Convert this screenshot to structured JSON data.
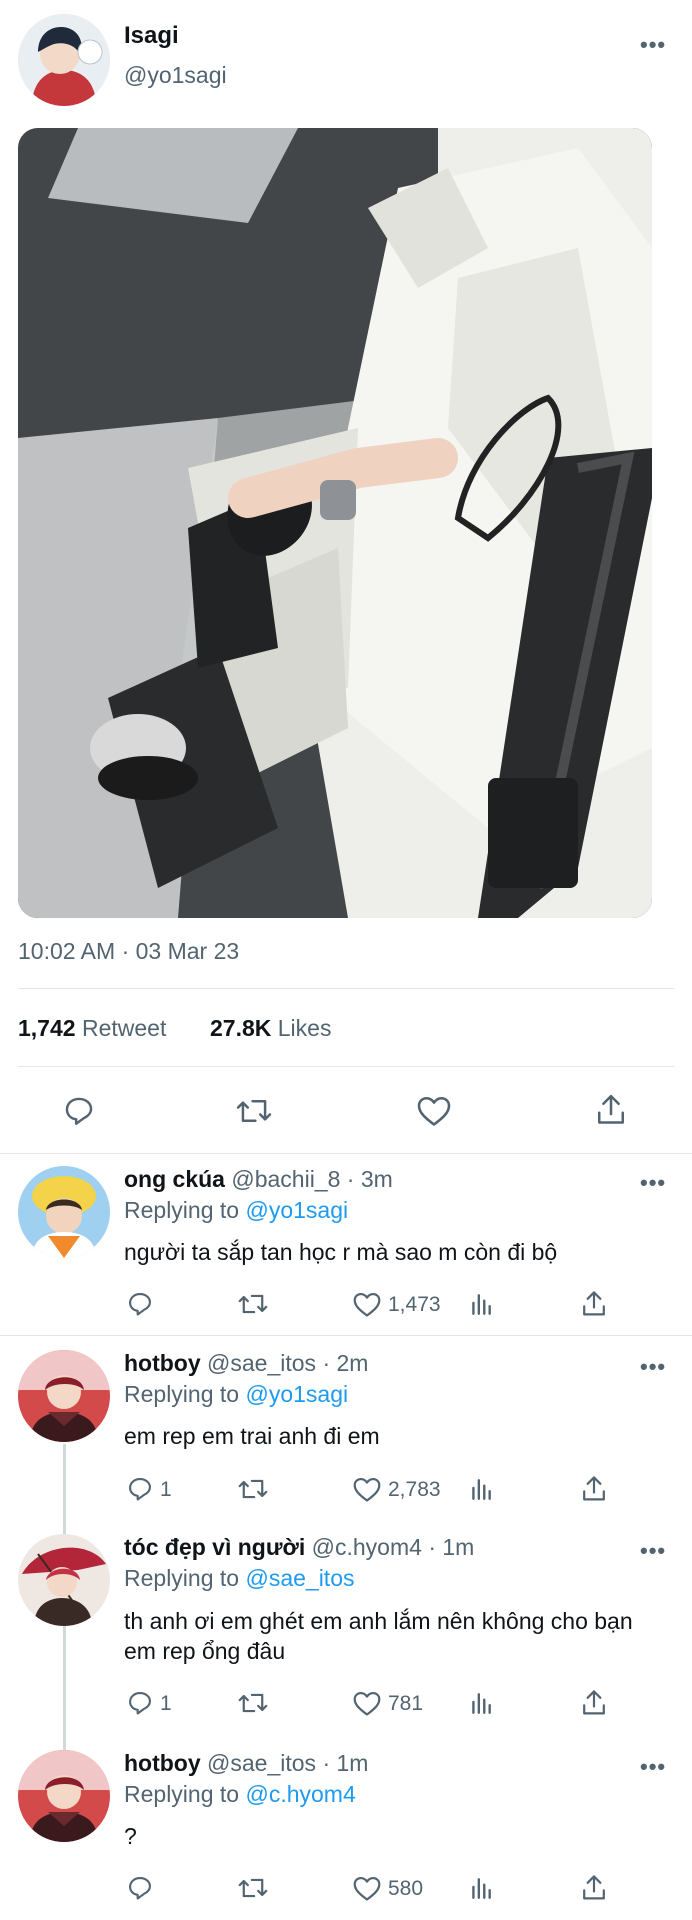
{
  "tweet": {
    "display_name": "Isagi",
    "handle": "@yo1sagi",
    "timestamp": "10:02 AM · 03 Mar 23",
    "retweet_count": "1,742",
    "retweet_label": "Retweet",
    "likes_count": "27.8K",
    "likes_label": "Likes",
    "more": "•••"
  },
  "replies": [
    {
      "display_name": "ong ckúa",
      "handle": "@bachii_8",
      "time": "· 3m",
      "replying_label": "Replying to",
      "replying_to": "@yo1sagi",
      "text": "người ta sắp tan học r mà sao m còn đi bộ",
      "reply_count": "",
      "like_count": "1,473"
    },
    {
      "display_name": "hotboy",
      "handle": "@sae_itos",
      "time": "· 2m",
      "replying_label": "Replying to",
      "replying_to": "@yo1sagi",
      "text": "em rep em trai anh đi em",
      "reply_count": "1",
      "like_count": "2,783"
    },
    {
      "display_name": "tóc đẹp vì người",
      "handle": "@c.hyom4",
      "time": "· 1m",
      "replying_label": "Replying to",
      "replying_to": "@sae_itos",
      "text": "th anh ơi em ghét em anh lắm nên không cho bạn em rep ổng đâu",
      "reply_count": "1",
      "like_count": "781"
    },
    {
      "display_name": "hotboy",
      "handle": "@sae_itos",
      "time": "· 1m",
      "replying_label": "Replying to",
      "replying_to": "@c.hyom4",
      "text": "?",
      "reply_count": "",
      "like_count": "580"
    }
  ],
  "colors": {
    "link": "#1d9bf0",
    "muted": "#536471",
    "divider": "#e1e6ea"
  },
  "icons": [
    "reply-icon",
    "retweet-icon",
    "like-icon",
    "share-icon",
    "analytics-icon",
    "more-icon"
  ]
}
